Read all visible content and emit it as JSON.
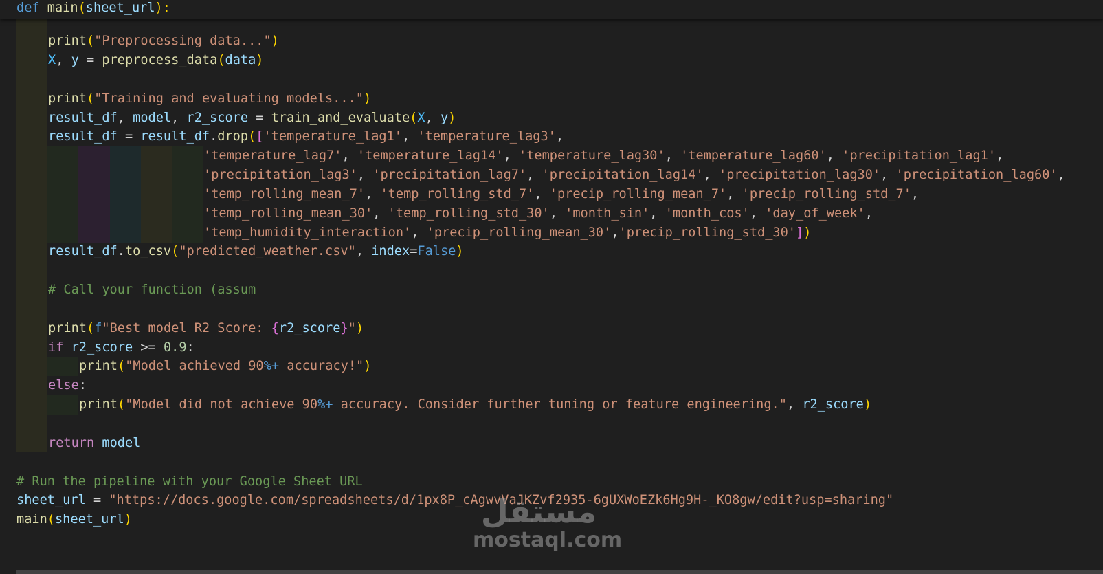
{
  "editor": {
    "sticky_scroll": {
      "def_keyword": "def",
      "function_name": "main",
      "open_paren": "(",
      "param": "sheet_url",
      "close_colon": "):"
    },
    "code": {
      "print1": {
        "fn": "print",
        "arg": "\"Preprocessing data...\""
      },
      "preprocess": {
        "x": "X",
        "y": "y",
        "fn": "preprocess_data",
        "arg": "data"
      },
      "print2": {
        "fn": "print",
        "arg": "\"Training and evaluating models...\""
      },
      "train": {
        "v1": "result_df",
        "v2": "model",
        "v3": "r2_score",
        "fn": "train_and_evaluate",
        "a1": "X",
        "a2": "y"
      },
      "drop": {
        "target": "result_df",
        "source": "result_df",
        "method": "drop",
        "line1": [
          "'temperature_lag1'",
          "'temperature_lag3'"
        ],
        "line2": [
          "'temperature_lag7'",
          "'temperature_lag14'",
          "'temperature_lag30'",
          "'temperature_lag60'",
          "'precipitation_lag1'"
        ],
        "line3": [
          "'precipitation_lag3'",
          "'precipitation_lag7'",
          "'precipitation_lag14'",
          "'precipitation_lag30'",
          "'precipitation_lag60'"
        ],
        "line4": [
          "'temp_rolling_mean_7'",
          "'temp_rolling_std_7'",
          "'precip_rolling_mean_7'",
          "'precip_rolling_std_7'"
        ],
        "line5": [
          "'temp_rolling_mean_30'",
          "'temp_rolling_std_30'",
          "'month_sin'",
          "'month_cos'",
          "'day_of_week'"
        ],
        "line6": [
          "'temp_humidity_interaction'",
          "'precip_rolling_mean_30'",
          "'precip_rolling_std_30'"
        ]
      },
      "to_csv": {
        "obj": "result_df",
        "method": "to_csv",
        "arg": "\"predicted_weather.csv\"",
        "kw": "index",
        "val": "False"
      },
      "comment1": "# Call your function (assum",
      "print3": {
        "fn": "print",
        "prefix": "f",
        "str_a": "\"Best model R2 Score: ",
        "expr": "r2_score",
        "str_b": "\""
      },
      "if_line": {
        "kw": "if",
        "var": "r2_score",
        "op": ">=",
        "num": "0.9",
        "colon": ":"
      },
      "print4": {
        "fn": "print",
        "str_a": "\"Model achieved 90",
        "fmt": "%+",
        "str_b": " accuracy!\""
      },
      "else_line": {
        "kw": "else",
        "colon": ":"
      },
      "print5": {
        "fn": "print",
        "str_a": "\"Model did not achieve 90",
        "fmt": "%+",
        "str_b": " accuracy. Consider further tuning or feature engineering.\"",
        "arg2": "r2_score"
      },
      "return_line": {
        "kw": "return",
        "var": "model"
      },
      "comment2": "# Run the pipeline with your Google Sheet URL",
      "sheet": {
        "var": "sheet_url",
        "q1": "\"",
        "url": "https://docs.google.com/spreadsheets/d/1px8P_cAgwvVaJKZvf2935-6gUXWoEZk6Hg9H-_KO8gw/edit?usp=sharing",
        "q2": "\""
      },
      "call": {
        "fn": "main",
        "arg": "sheet_url"
      }
    }
  },
  "watermark": {
    "logo": "مستقل",
    "text": "mostaql.com"
  },
  "colors": {
    "background": "#1f1f1f",
    "keyword": "#569cd6",
    "control": "#c586c0",
    "function": "#dcdcaa",
    "variable": "#9cdcfe",
    "string": "#ce9178",
    "comment": "#6a9955",
    "number": "#b5cea8"
  }
}
